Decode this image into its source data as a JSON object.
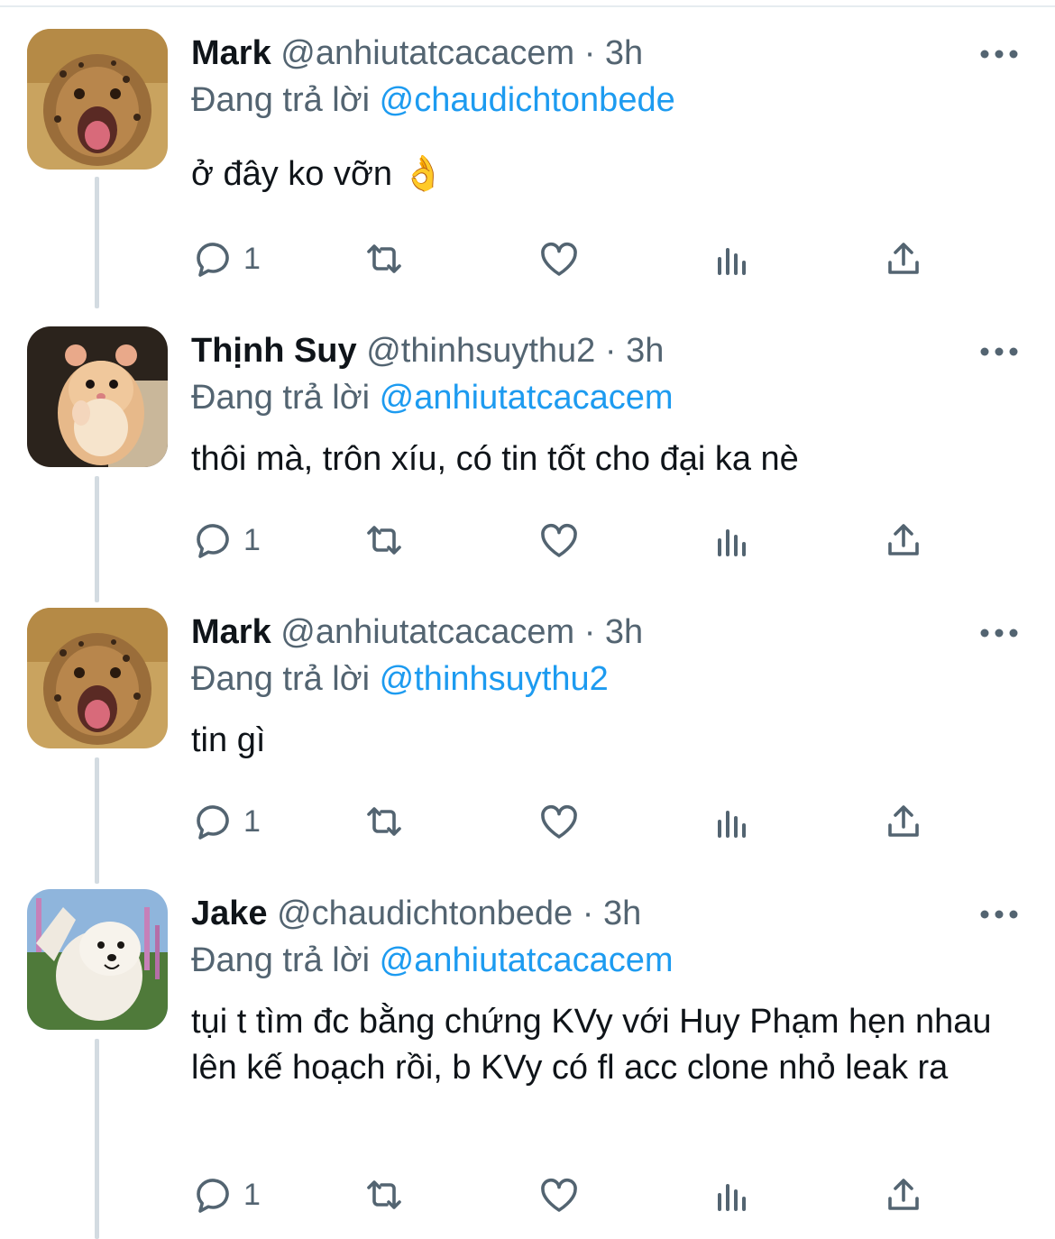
{
  "colors": {
    "text": "#0f1419",
    "secondary": "#536471",
    "link": "#1d9bf0",
    "thread_line": "#d3dbe1"
  },
  "more_icon": "more-horizontal-icon",
  "tweets": [
    {
      "name": "Mark",
      "handle": "@anhiutatcacacem",
      "sep": "·",
      "time": "3h",
      "reply_prefix": "Đang trả lời",
      "reply_to": "@chaudichtonbede",
      "text": "ở đây ko vỡn 👌",
      "avatar": "cheetah-cub-avatar",
      "reply_count": "1"
    },
    {
      "name": "Thịnh Suy",
      "handle": "@thinhsuythu2",
      "sep": "·",
      "time": "3h",
      "reply_prefix": "Đang trả lời",
      "reply_to": "@anhiutatcacacem",
      "text": "thôi mà, trôn xíu, có tin tốt cho đại ka nè",
      "avatar": "hamster-avatar",
      "reply_count": "1"
    },
    {
      "name": "Mark",
      "handle": "@anhiutatcacacem",
      "sep": "·",
      "time": "3h",
      "reply_prefix": "Đang trả lời",
      "reply_to": "@thinhsuythu2",
      "text": "tin gì",
      "avatar": "cheetah-cub-avatar",
      "reply_count": "1"
    },
    {
      "name": "Jake",
      "handle": "@chaudichtonbede",
      "sep": "·",
      "time": "3h",
      "reply_prefix": "Đang trả lời",
      "reply_to": "@anhiutatcacacem",
      "text": "tụi t tìm đc bằng chứng KVy với Huy Phạm hẹn nhau lên kế hoạch rồi, b KVy có fl acc clone nhỏ leak ra",
      "avatar": "samoyed-dog-avatar",
      "reply_count": "1"
    }
  ],
  "action_icons": [
    "reply-icon",
    "retweet-icon",
    "like-icon",
    "analytics-icon",
    "share-icon"
  ]
}
